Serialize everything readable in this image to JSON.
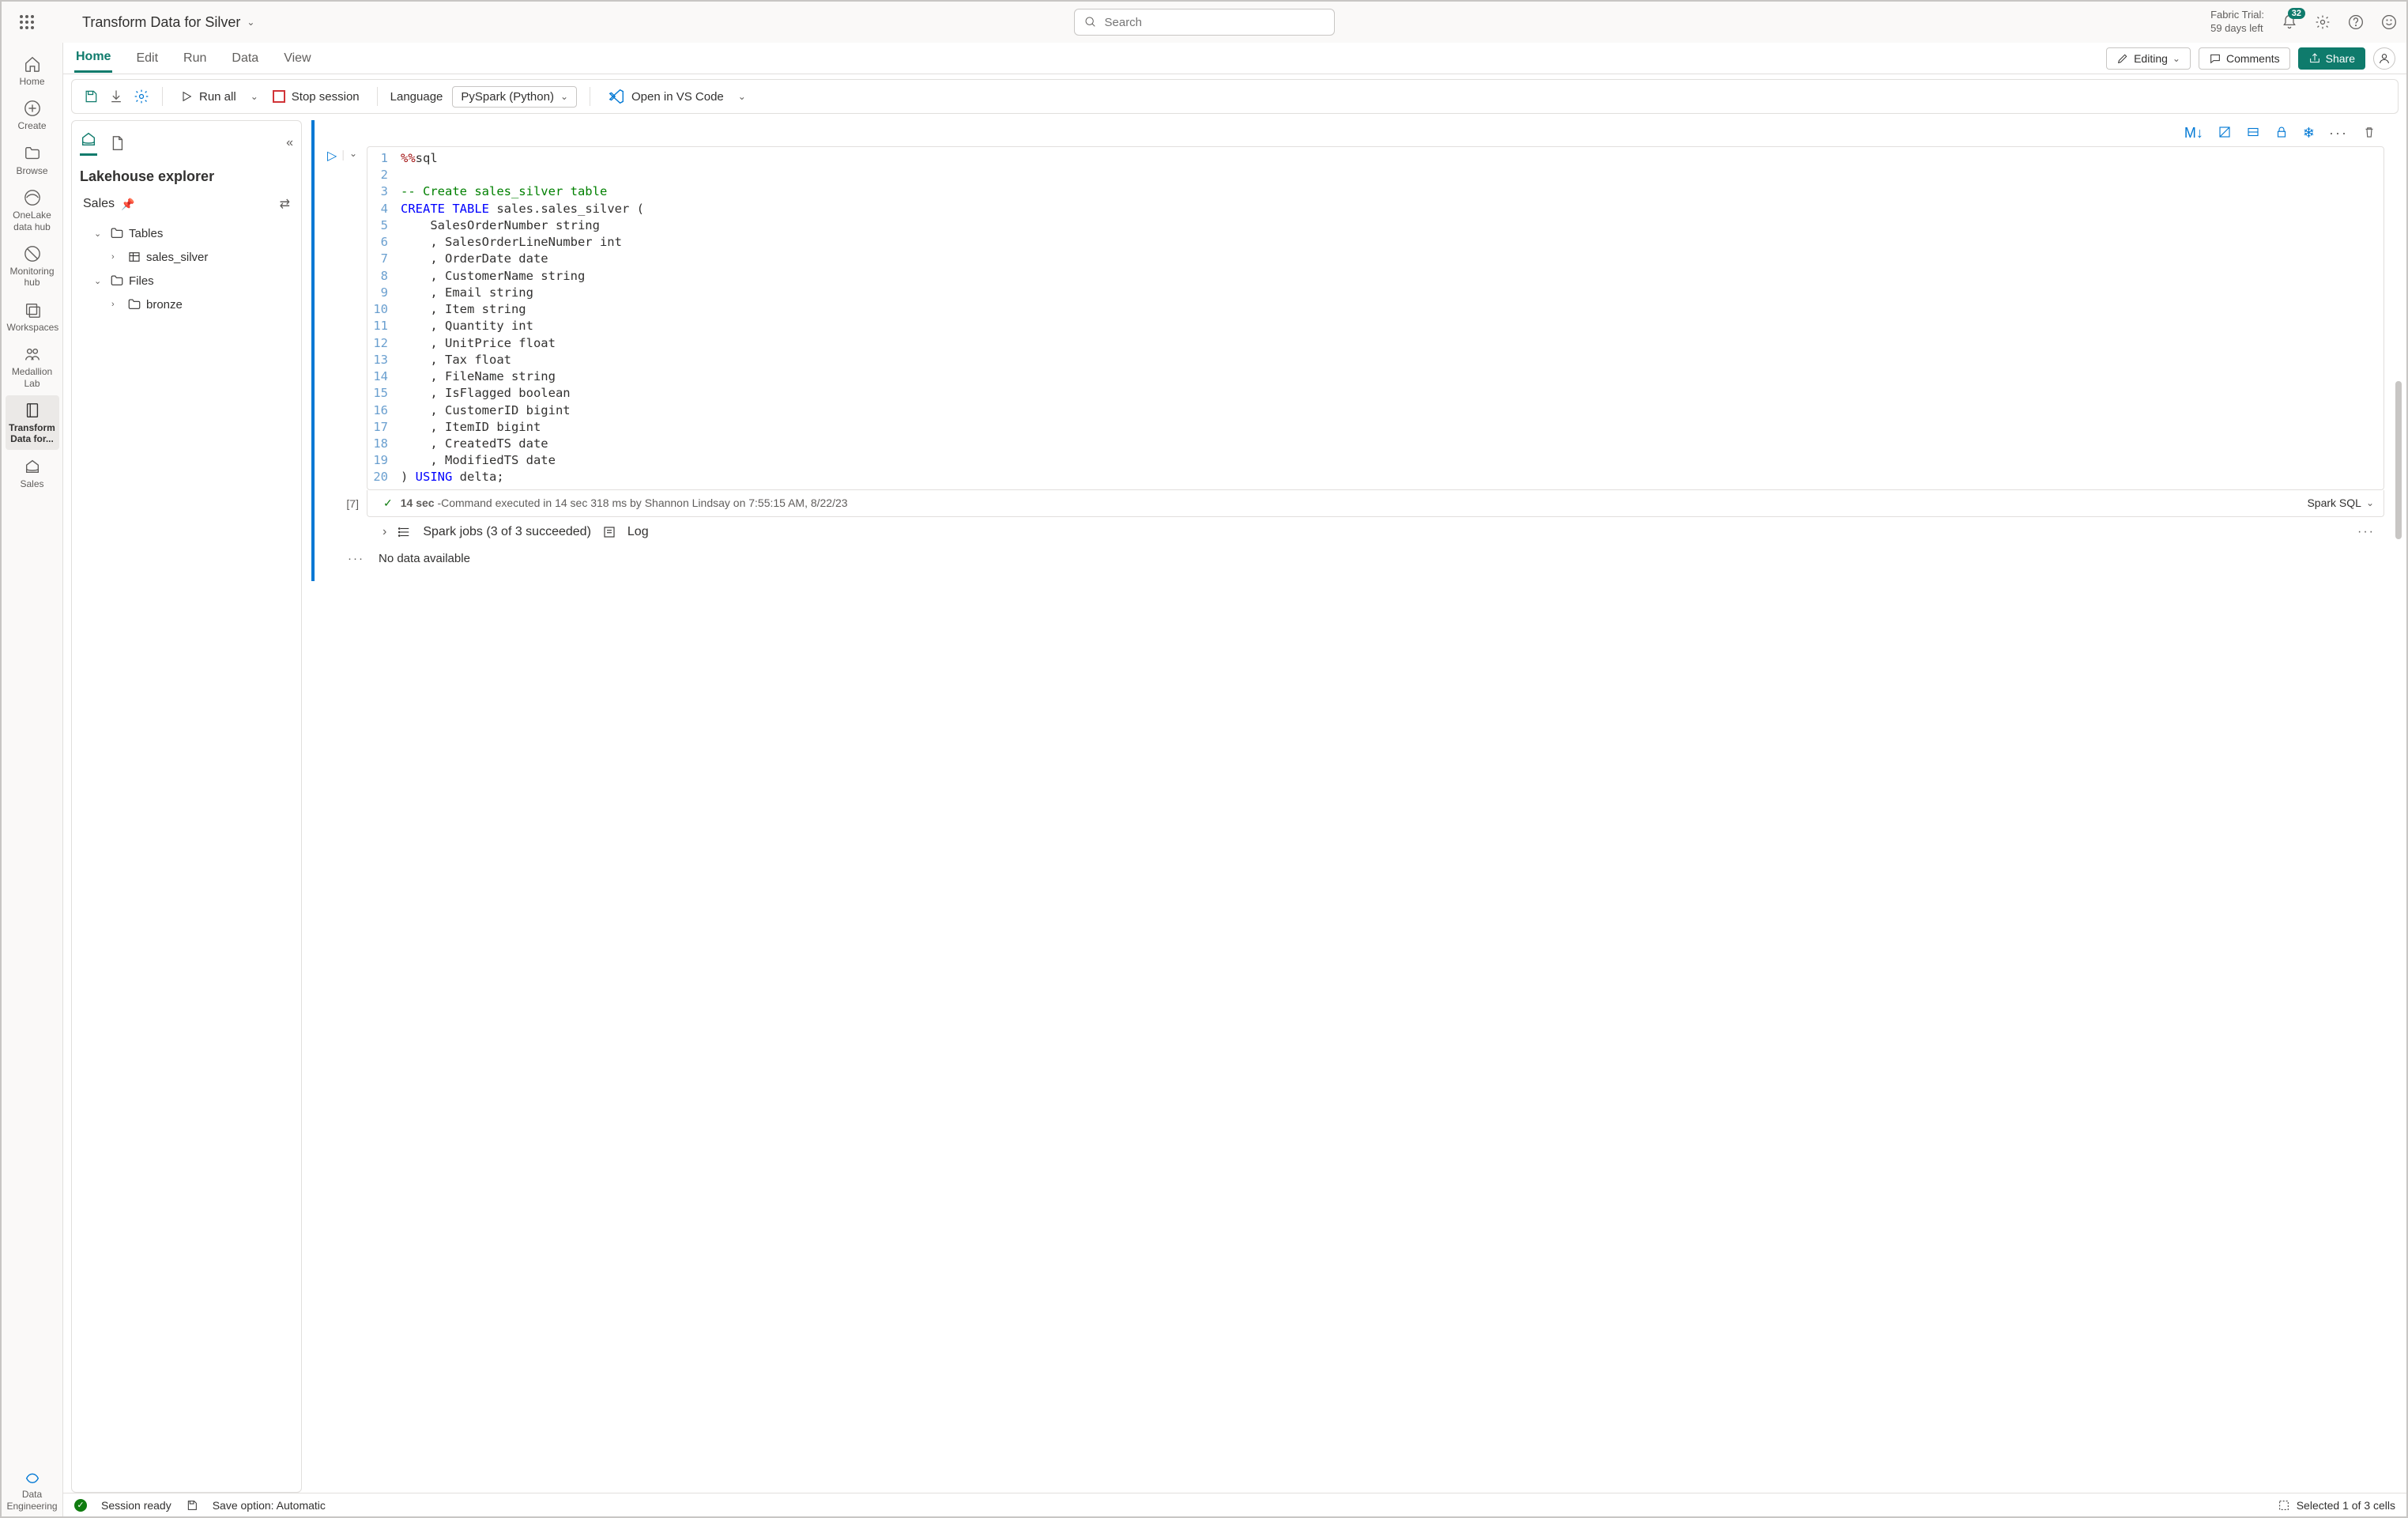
{
  "header": {
    "title": "Transform Data for Silver",
    "search_placeholder": "Search",
    "trial_line1": "Fabric Trial:",
    "trial_line2": "59 days left",
    "notification_count": "32"
  },
  "nav": {
    "home": "Home",
    "create": "Create",
    "browse": "Browse",
    "onelake": "OneLake data hub",
    "monitoring": "Monitoring hub",
    "workspaces": "Workspaces",
    "medallion": "Medallion Lab",
    "transform": "Transform Data for...",
    "sales": "Sales",
    "persona": "Data Engineering"
  },
  "ribbon": {
    "tabs": [
      "Home",
      "Edit",
      "Run",
      "Data",
      "View"
    ],
    "editing": "Editing",
    "comments": "Comments",
    "share": "Share"
  },
  "toolbar": {
    "run_all": "Run all",
    "stop": "Stop session",
    "language_label": "Language",
    "language_value": "PySpark (Python)",
    "vscode": "Open in VS Code"
  },
  "explorer": {
    "title": "Lakehouse explorer",
    "lakehouse": "Sales",
    "tables": "Tables",
    "table_item": "sales_silver",
    "files": "Files",
    "folder_item": "bronze"
  },
  "cell": {
    "lines": [
      [
        {
          "t": "%%",
          "c": "tok-magic"
        },
        {
          "t": "sql",
          "c": ""
        }
      ],
      [
        {
          "t": "",
          "c": ""
        }
      ],
      [
        {
          "t": "-- Create sales_silver table",
          "c": "tok-comment"
        }
      ],
      [
        {
          "t": "CREATE",
          "c": "tok-kw"
        },
        {
          "t": " ",
          "c": ""
        },
        {
          "t": "TABLE",
          "c": "tok-kw"
        },
        {
          "t": " sales.sales_silver (",
          "c": ""
        }
      ],
      [
        {
          "t": "    SalesOrderNumber string",
          "c": ""
        }
      ],
      [
        {
          "t": "    , SalesOrderLineNumber int",
          "c": ""
        }
      ],
      [
        {
          "t": "    , OrderDate date",
          "c": ""
        }
      ],
      [
        {
          "t": "    , CustomerName string",
          "c": ""
        }
      ],
      [
        {
          "t": "    , Email string",
          "c": ""
        }
      ],
      [
        {
          "t": "    , Item string",
          "c": ""
        }
      ],
      [
        {
          "t": "    , Quantity int",
          "c": ""
        }
      ],
      [
        {
          "t": "    , UnitPrice float",
          "c": ""
        }
      ],
      [
        {
          "t": "    , Tax float",
          "c": ""
        }
      ],
      [
        {
          "t": "    , FileName string",
          "c": ""
        }
      ],
      [
        {
          "t": "    , IsFlagged boolean",
          "c": ""
        }
      ],
      [
        {
          "t": "    , CustomerID bigint",
          "c": ""
        }
      ],
      [
        {
          "t": "    , ItemID bigint",
          "c": ""
        }
      ],
      [
        {
          "t": "    , CreatedTS date",
          "c": ""
        }
      ],
      [
        {
          "t": "    , ModifiedTS date",
          "c": ""
        }
      ],
      [
        {
          "t": ") ",
          "c": ""
        },
        {
          "t": "USING",
          "c": "tok-kw"
        },
        {
          "t": " delta;",
          "c": ""
        }
      ]
    ],
    "exec_count": "[7]",
    "status_time": "14 sec",
    "status_text": " -Command executed in 14 sec 318 ms by Shannon Lindsay on 7:55:15 AM, 8/22/23",
    "lang": "Spark SQL",
    "spark_jobs": "Spark jobs (3 of 3 succeeded)",
    "log": "Log",
    "no_data": "No data available"
  },
  "statusbar": {
    "session": "Session ready",
    "save": "Save option: Automatic",
    "selection": "Selected 1 of 3 cells"
  }
}
